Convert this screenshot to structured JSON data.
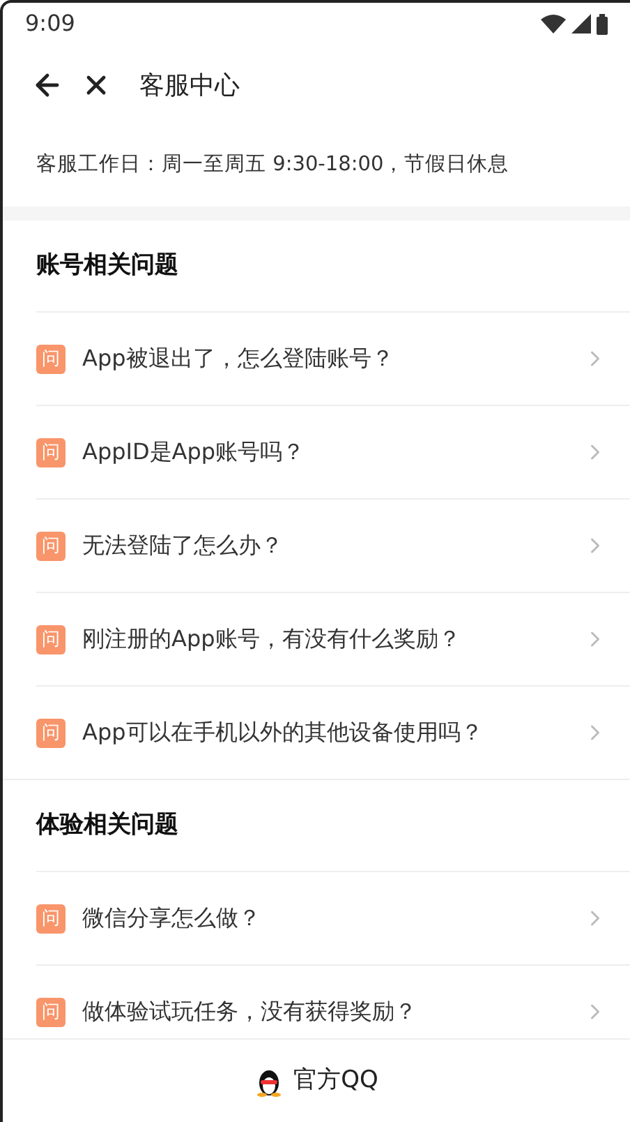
{
  "status_bar": {
    "time": "9:09"
  },
  "header": {
    "title": "客服中心"
  },
  "notice": "客服工作日：周一至周五 9:30-18:00，节假日休息",
  "sections": [
    {
      "title": "账号相关问题",
      "items": [
        {
          "badge": "问",
          "question": "App被退出了，怎么登陆账号？"
        },
        {
          "badge": "问",
          "question": "AppID是App账号吗？"
        },
        {
          "badge": "问",
          "question": "无法登陆了怎么办？"
        },
        {
          "badge": "问",
          "question": "刚注册的App账号，有没有什么奖励？"
        },
        {
          "badge": "问",
          "question": "App可以在手机以外的其他设备使用吗？"
        }
      ]
    },
    {
      "title": "体验相关问题",
      "items": [
        {
          "badge": "问",
          "question": "微信分享怎么做？"
        },
        {
          "badge": "问",
          "question": "做体验试玩任务，没有获得奖励？"
        }
      ]
    }
  ],
  "bottom_bar": {
    "label": "官方QQ"
  }
}
